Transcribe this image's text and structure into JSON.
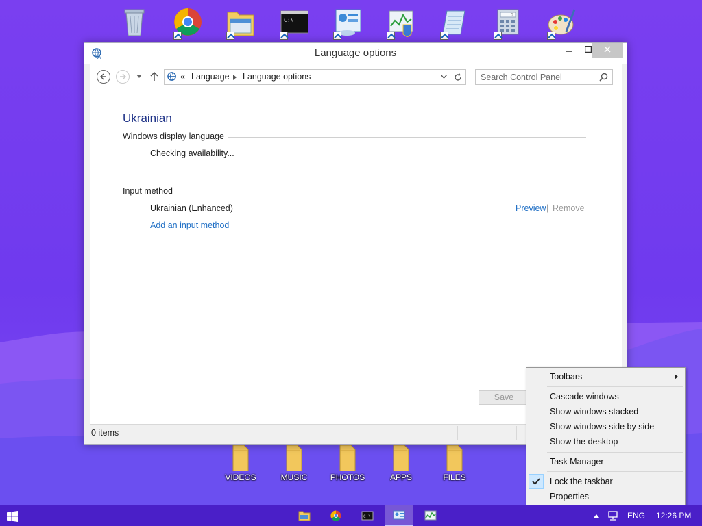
{
  "desktop": {
    "folders": [
      {
        "label": "VIDEOS"
      },
      {
        "label": "MUSIC"
      },
      {
        "label": "PHOTOS"
      },
      {
        "label": "APPS"
      },
      {
        "label": "FILES"
      }
    ]
  },
  "window": {
    "title": "Language options",
    "breadcrumb": {
      "prefix": "«",
      "items": [
        "Language",
        "Language options"
      ]
    },
    "search_placeholder": "Search Control Panel",
    "language_name": "Ukrainian",
    "display_section": "Windows display language",
    "display_status": "Checking availability...",
    "input_section": "Input method",
    "input_method": "Ukrainian (Enhanced)",
    "preview_link": "Preview",
    "remove_link": "Remove",
    "separator": "|",
    "add_input_link": "Add an input method",
    "save_label": "Save",
    "status_items": "0 items"
  },
  "context_menu": {
    "toolbars": "Toolbars",
    "cascade": "Cascade windows",
    "stacked": "Show windows stacked",
    "side_by_side": "Show windows side by side",
    "show_desktop": "Show the desktop",
    "task_manager": "Task Manager",
    "lock_taskbar": "Lock the taskbar",
    "lock_checked": true,
    "properties": "Properties"
  },
  "taskbar": {
    "language": "ENG",
    "time": "12:26 PM"
  },
  "colors": {
    "accent_link": "#1f6fc5",
    "heading": "#1e3287",
    "taskbar": "#4a1fc8"
  }
}
